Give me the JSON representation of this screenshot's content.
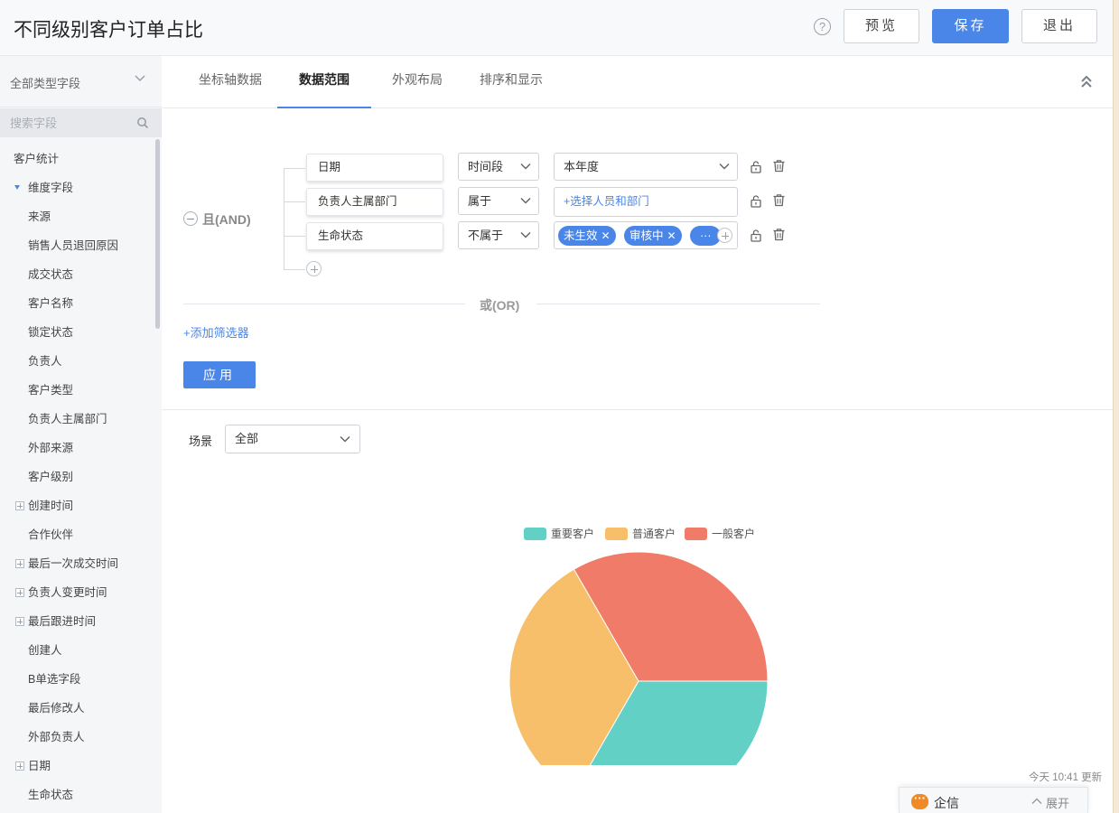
{
  "header": {
    "title": "不同级别客户订单占比",
    "help": "?",
    "preview_label": "预览",
    "save_label": "保存",
    "exit_label": "退出"
  },
  "sidebar": {
    "field_type": "全部类型字段",
    "search_placeholder": "搜索字段",
    "items": [
      {
        "label": "客户统计",
        "level": 0,
        "icon": "none"
      },
      {
        "label": "维度字段",
        "level": 1,
        "icon": "triangle-down-icon"
      },
      {
        "label": "来源",
        "level": 2,
        "icon": "none"
      },
      {
        "label": "销售人员退回原因",
        "level": 2,
        "icon": "none"
      },
      {
        "label": "成交状态",
        "level": 2,
        "icon": "none"
      },
      {
        "label": "客户名称",
        "level": 2,
        "icon": "none"
      },
      {
        "label": "锁定状态",
        "level": 2,
        "icon": "none"
      },
      {
        "label": "负责人",
        "level": 2,
        "icon": "none"
      },
      {
        "label": "客户类型",
        "level": 2,
        "icon": "none"
      },
      {
        "label": "负责人主属部门",
        "level": 2,
        "icon": "none"
      },
      {
        "label": "外部来源",
        "level": 2,
        "icon": "none"
      },
      {
        "label": "客户级别",
        "level": 2,
        "icon": "none"
      },
      {
        "label": "创建时间",
        "level": 2,
        "icon": "plus-box-icon"
      },
      {
        "label": "合作伙伴",
        "level": 2,
        "icon": "none"
      },
      {
        "label": "最后一次成交时间",
        "level": 2,
        "icon": "plus-box-icon"
      },
      {
        "label": "负责人变更时间",
        "level": 2,
        "icon": "plus-box-icon"
      },
      {
        "label": "最后跟进时间",
        "level": 2,
        "icon": "plus-box-icon"
      },
      {
        "label": "创建人",
        "level": 2,
        "icon": "none"
      },
      {
        "label": "B单选字段",
        "level": 2,
        "icon": "none"
      },
      {
        "label": "最后修改人",
        "level": 2,
        "icon": "none"
      },
      {
        "label": "外部负责人",
        "level": 2,
        "icon": "none"
      },
      {
        "label": "日期",
        "level": 2,
        "icon": "plus-box-icon"
      },
      {
        "label": "生命状态",
        "level": 2,
        "icon": "none"
      }
    ]
  },
  "tabs": [
    {
      "label": "坐标轴数据",
      "active": false
    },
    {
      "label": "数据范围",
      "active": true
    },
    {
      "label": "外观布局",
      "active": false
    },
    {
      "label": "排序和显示",
      "active": false
    }
  ],
  "filter": {
    "and_label": "且(AND)",
    "or_label": "或(OR)",
    "add_filter_label": "+添加筛选器",
    "apply_label": "应用",
    "conditions": [
      {
        "field": "日期",
        "operator": "时间段",
        "value": "本年度"
      },
      {
        "field": "负责人主属部门",
        "operator": "属于",
        "value_link": "+选择人员和部门"
      },
      {
        "field": "生命状态",
        "operator": "不属于",
        "tags": [
          "未生效",
          "审核中",
          "···"
        ]
      }
    ]
  },
  "scene": {
    "label": "场景",
    "value": "全部"
  },
  "chart_data": {
    "type": "pie",
    "title": "",
    "legend_position": "top-center",
    "slices": [
      {
        "name": "重要客户",
        "value": 33.33,
        "color": "#63d0c5"
      },
      {
        "name": "普通客户",
        "value": 33.33,
        "color": "#f7bf69"
      },
      {
        "name": "一般客户",
        "value": 33.34,
        "color": "#f07b69"
      }
    ]
  },
  "update_text": "今天 10:41 更新",
  "chat": {
    "title": "企信",
    "expand_label": "展开"
  },
  "colors": {
    "primary": "#4a86e8"
  }
}
